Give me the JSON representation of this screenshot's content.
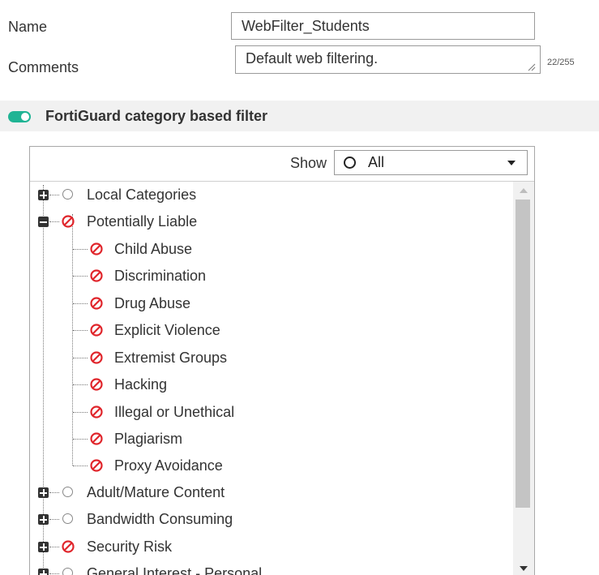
{
  "form": {
    "name_label": "Name",
    "name_value": "WebFilter_Students",
    "comments_label": "Comments",
    "comments_value": "Default web filtering.",
    "comments_counter": "22/255"
  },
  "section": {
    "title": "FortiGuard category based filter",
    "toggle_on": true,
    "accent_color": "#20b494"
  },
  "filter": {
    "show_label": "Show",
    "selected": "All"
  },
  "tree": [
    {
      "label": "Local Categories",
      "action": "allow",
      "expandable": true,
      "expanded": false,
      "children": []
    },
    {
      "label": "Potentially Liable",
      "action": "block",
      "expandable": true,
      "expanded": true,
      "children": [
        {
          "label": "Child Abuse",
          "action": "block"
        },
        {
          "label": "Discrimination",
          "action": "block"
        },
        {
          "label": "Drug Abuse",
          "action": "block"
        },
        {
          "label": "Explicit Violence",
          "action": "block"
        },
        {
          "label": "Extremist Groups",
          "action": "block"
        },
        {
          "label": "Hacking",
          "action": "block"
        },
        {
          "label": "Illegal or Unethical",
          "action": "block"
        },
        {
          "label": "Plagiarism",
          "action": "block"
        },
        {
          "label": "Proxy Avoidance",
          "action": "block"
        }
      ]
    },
    {
      "label": "Adult/Mature Content",
      "action": "allow",
      "expandable": true,
      "expanded": false,
      "children": []
    },
    {
      "label": "Bandwidth Consuming",
      "action": "allow",
      "expandable": true,
      "expanded": false,
      "children": []
    },
    {
      "label": "Security Risk",
      "action": "block",
      "expandable": true,
      "expanded": false,
      "children": []
    },
    {
      "label": "General Interest - Personal",
      "action": "allow",
      "expandable": true,
      "expanded": false,
      "children": []
    }
  ],
  "icons": {
    "allow": "circle-outline-icon",
    "block": "block-icon",
    "block_color": "#e0262c"
  }
}
